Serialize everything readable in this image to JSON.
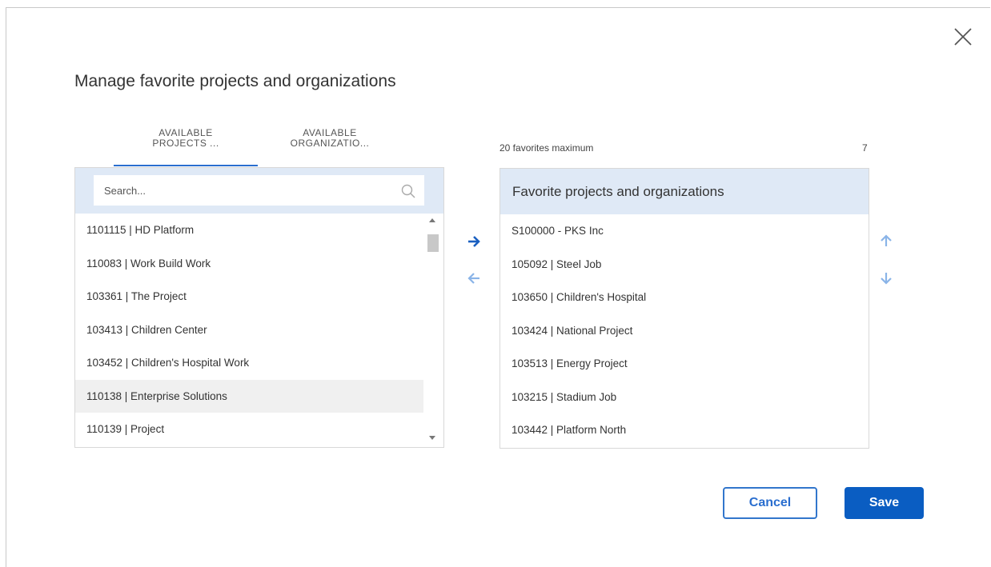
{
  "dialog": {
    "title": "Manage favorite projects and organizations",
    "close_icon": "close-icon"
  },
  "tabs": [
    {
      "line1": "AVAILABLE",
      "line2": "PROJECTS ...",
      "active": true
    },
    {
      "line1": "AVAILABLE",
      "line2": "ORGANIZATIO...",
      "active": false
    }
  ],
  "search": {
    "placeholder": "Search...",
    "value": ""
  },
  "available_list": [
    "1101115 | HD Platform",
    "110083 | Work Build Work",
    "103361 | The Project",
    "103413 | Children Center",
    "103452 | Children's Hospital Work",
    "110138 | Enterprise Solutions",
    "110139 | Project"
  ],
  "highlighted_index": 5,
  "favorites": {
    "max_text": "20 favorites maximum",
    "count": "7",
    "header": "Favorite projects and organizations",
    "items": [
      "S100000 - PKS Inc",
      "105092 | Steel Job",
      "103650 | Children's Hospital",
      "103424 | National Project",
      "103513 | Energy Project",
      "103215 | Stadium Job",
      "103442 | Platform North"
    ]
  },
  "buttons": {
    "cancel": "Cancel",
    "save": "Save"
  },
  "colors": {
    "accent": "#2a6ecf",
    "arrow_active": "#1a5fc0",
    "arrow_inactive": "#8ab4e8",
    "panel_header": "#dfe9f6",
    "save_bg": "#0a5dc2"
  }
}
